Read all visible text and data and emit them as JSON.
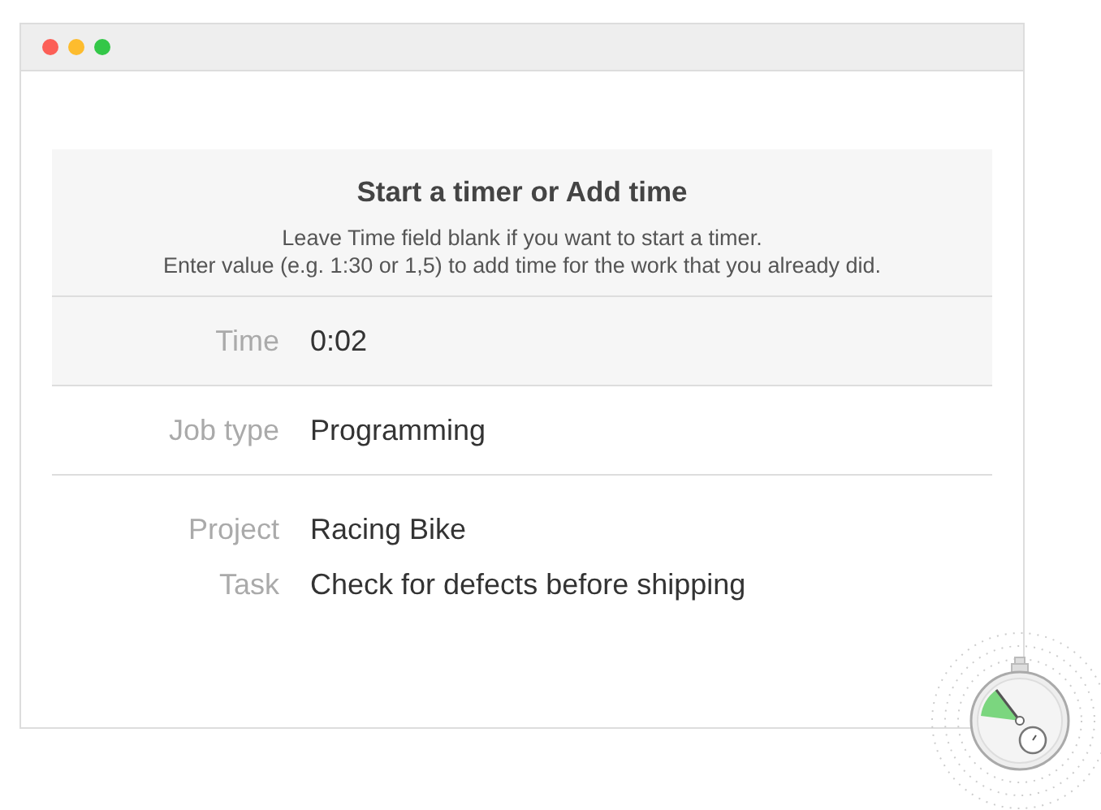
{
  "window": {
    "controls": [
      {
        "color": "#fc5f57"
      },
      {
        "color": "#fdbc2e"
      },
      {
        "color": "#33c748"
      }
    ]
  },
  "header": {
    "title": "Start a timer or Add time",
    "lines": [
      "Leave Time field blank if you want to start a timer.",
      "Enter value (e.g. 1:30 or 1,5) to add time for the work that you already did."
    ]
  },
  "sections": [
    {
      "kind": "input",
      "rows": [
        {
          "label": "Time",
          "value": "0:02"
        }
      ]
    },
    {
      "kind": "select",
      "rows": [
        {
          "label": "Job type",
          "value": "Programming"
        }
      ]
    },
    {
      "kind": "info",
      "rows": [
        {
          "label": "Project",
          "value": "Racing Bike"
        },
        {
          "label": "Task",
          "value": "Check for defects before shipping"
        }
      ]
    }
  ]
}
